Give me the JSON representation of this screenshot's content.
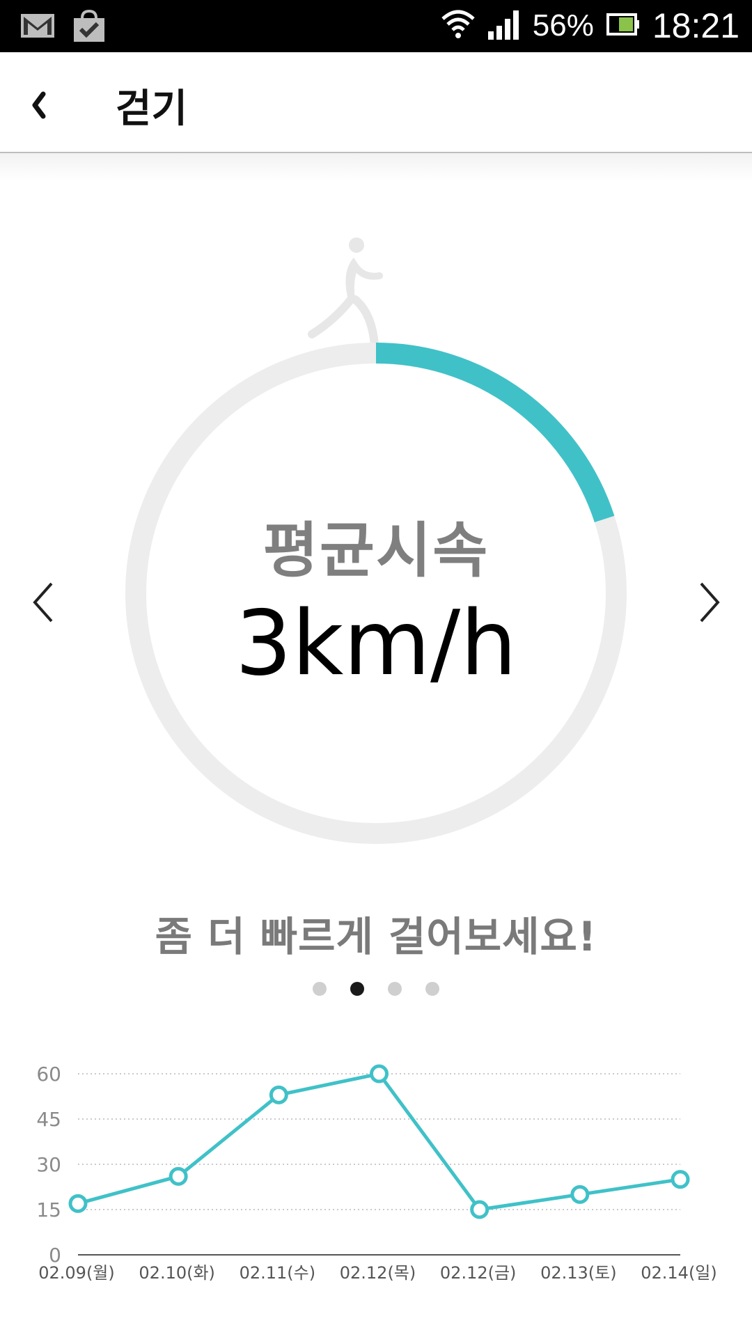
{
  "status_bar": {
    "battery_percent": "56%",
    "time": "18:21",
    "icons": [
      "gmail-icon",
      "shopping-bag-check-icon",
      "wifi-icon",
      "signal-icon",
      "battery-icon"
    ]
  },
  "app_bar": {
    "back_icon": "chevron-left-icon",
    "title": "걷기"
  },
  "gauge": {
    "icon": "walking-person-icon",
    "label": "평균시속",
    "value": "3km/h",
    "progress_fraction": 0.2,
    "progress_color": "#40c1c8",
    "track_color": "#ededed"
  },
  "message": "좀 더 빠르게 걸어보세요!",
  "pager": {
    "count": 4,
    "active_index": 1
  },
  "chart_data": {
    "type": "line",
    "categories": [
      "02.09(월)",
      "02.10(화)",
      "02.11(수)",
      "02.12(목)",
      "02.12(금)",
      "02.13(토)",
      "02.14(일)"
    ],
    "series": [
      {
        "values": [
          17,
          26,
          53,
          60,
          15,
          20,
          25
        ],
        "color": "#40c1c8"
      }
    ],
    "yticks": [
      0,
      15,
      30,
      45,
      60
    ],
    "ylim": [
      0,
      60
    ],
    "grid": true
  }
}
